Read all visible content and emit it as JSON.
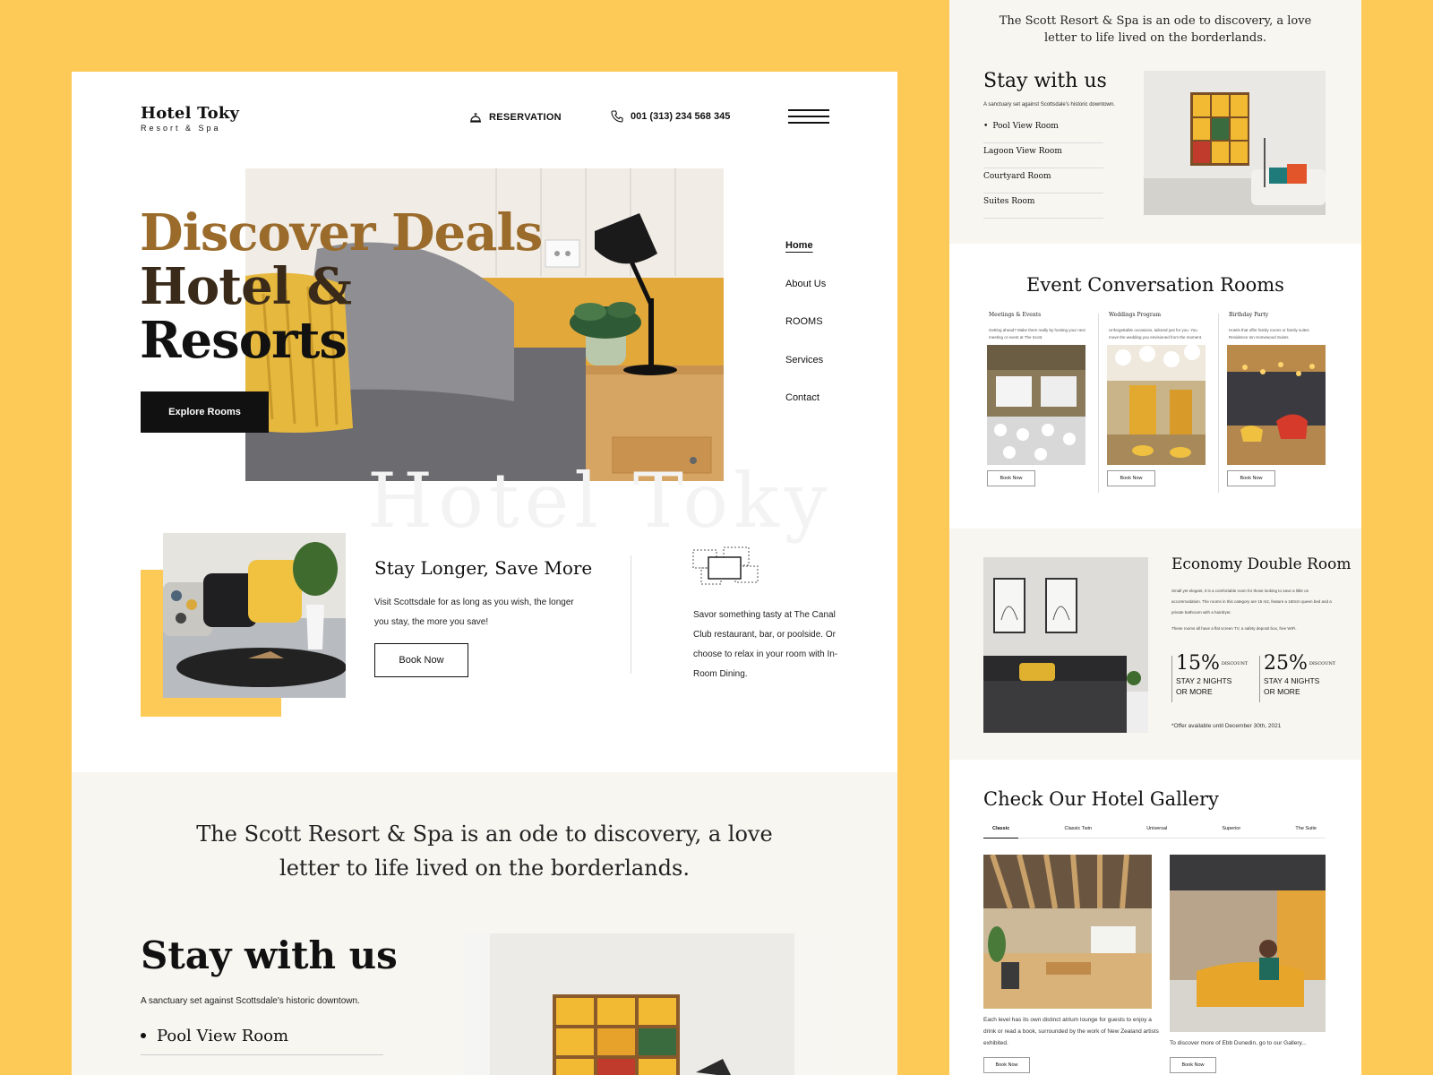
{
  "colors": {
    "background": "#fdc957",
    "accent_gold": "#9a6b2b",
    "dark": "#111111",
    "cream": "#f8f6f1"
  },
  "header": {
    "logo_name": "Hotel Toky",
    "logo_tagline": "Resort & Spa",
    "reservation": "RESERVATION",
    "reservation_icon": "reception-bell-icon",
    "phone": "001 (313) 234 568 345",
    "phone_icon": "phone-icon",
    "menu_icon": "hamburger-menu-icon"
  },
  "hero": {
    "title_line1": "Discover Deals",
    "title_line2": "Hotel &",
    "title_line3": "Resorts",
    "cta": "Explore Rooms"
  },
  "side_nav": [
    "Home",
    "About Us",
    "ROOMS",
    "Services",
    "Contact"
  ],
  "watermark": "Hotel Toky",
  "stay_longer": {
    "title": "Stay Longer, Save More",
    "text": "Visit Scottsdale for as long as you wish, the longer you stay, the more you save!",
    "button": "Book Now"
  },
  "dining": {
    "text": "Savor something tasty at The Canal Club restaurant, bar, or poolside. Or choose to relax in your room with In-Room Dining."
  },
  "quote": {
    "line1": "The Scott Resort & Spa is an ode to discovery, a love",
    "line2": "letter to life lived on the borderlands."
  },
  "stay_with_us": {
    "title": "Stay with us",
    "subtitle": "A sanctuary set against Scottsdale's historic downtown.",
    "rooms": [
      "Pool View Room",
      "Lagoon View Room",
      "Courtyard Room",
      "Suites Room"
    ]
  },
  "events": {
    "title": "Event Conversation Rooms",
    "items": [
      {
        "title": "Meetings & Events",
        "desc": "Getting ahead? Make them really by hosting your next meeting or event at The Scott.",
        "button": "Book Now"
      },
      {
        "title": "Weddings Program",
        "desc": "Unforgettable occasions, tailored just for you. You move the wedding you envisioned from the moment.",
        "button": "Book Now"
      },
      {
        "title": "Birthday Party",
        "desc": "Hotels that offer family rooms or family suites Residence Inn Homewood Suites",
        "button": "Book Now"
      }
    ]
  },
  "economy": {
    "title": "Economy Double Room",
    "p1": "Small yet elegant, it is a comfortable room for those looking to save a little on accommodation. The rooms in this category are 15 m2, feature a 160cm queen bed and a private bathroom with a hairdryer.",
    "p2": "These rooms all have a flat screen TV, a safety deposit box, free WiFi.",
    "discount1_pct": "15%",
    "discount1_word": "DISCOUNT",
    "discount1_line1": "STAY 2 NIGHTS",
    "discount1_line2": "OR MORE",
    "discount2_pct": "25%",
    "discount2_word": "DISCOUNT",
    "discount2_line1": "STAY 4 NIGHTS",
    "discount2_line2": "OR MORE",
    "offer": "*Offer available until December 30th, 2021"
  },
  "gallery": {
    "title": "Check Our Hotel Gallery",
    "tabs": [
      "Classic",
      "Classic Twin",
      "Universal",
      "Superior",
      "The Suite"
    ],
    "active_tab": "Classic",
    "caption1": "Each level has its own distinct atrium lounge for guests to enjoy a drink or read a book, surrounded by the work of New Zealand artists exhibited.",
    "caption2": "To discover more of Ebb Dunedin, go to our Gallery...",
    "button": "Book Now"
  }
}
